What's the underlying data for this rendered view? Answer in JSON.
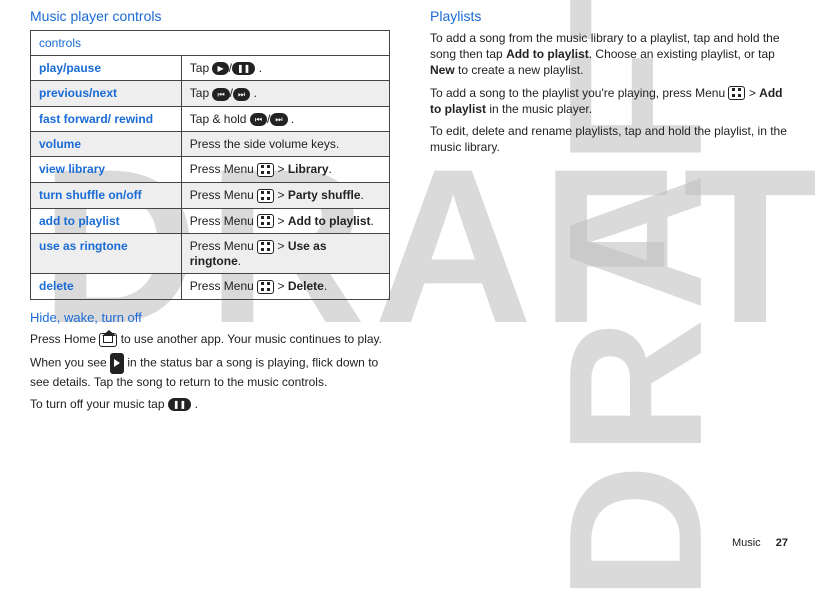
{
  "left": {
    "heading": "Music player controls",
    "tableHeader": "controls",
    "hideHeading": "Hide, wake, turn off"
  },
  "right": {
    "heading": "Playlists"
  },
  "rows": {
    "r0": {
      "label": "play/pause",
      "pre": "Tap ",
      "post": "."
    },
    "r1": {
      "label": "previous/next",
      "pre": "Tap ",
      "post": "."
    },
    "r2": {
      "label": "fast forward/ rewind",
      "pre": "Tap & hold ",
      "post": "."
    },
    "r3": {
      "label": "volume",
      "text": "Press the side volume keys."
    },
    "r4": {
      "label": "view library",
      "pre": "Press Menu",
      "mid": " > ",
      "bold": "Library",
      "post": "."
    },
    "r5": {
      "label": "turn shuffle on/off",
      "pre": "Press Menu",
      "mid": " > ",
      "bold": "Party shuffle",
      "post": "."
    },
    "r6": {
      "label": "add to playlist",
      "pre": "Press Menu",
      "mid": " > ",
      "bold": "Add to playlist",
      "post": "."
    },
    "r7": {
      "label": "use as ringtone",
      "pre": "Press Menu",
      "mid": " > ",
      "bold": "Use as ringtone",
      "post": "."
    },
    "r8": {
      "label": "delete",
      "pre": "Press Menu",
      "mid": " > ",
      "bold": "Delete",
      "post": "."
    }
  },
  "paras": {
    "hw1a": "Press Home",
    "hw1b": " to use another app. Your music continues to play.",
    "hw2a": "When you see ",
    "hw2b": " in the status bar a song is playing, flick down to see details. Tap the song to return to the music controls.",
    "hw3a": "To turn off your music tap ",
    "hw3b": ".",
    "pl1a": "To add a song from the music library to a playlist, tap and hold the song then tap ",
    "pl1bold1": "Add to playlist",
    "pl1b": ". Choose an existing playlist, or tap ",
    "pl1bold2": "New",
    "pl1c": " to create a new playlist.",
    "pl2a": "To add a song to the playlist you're playing, press Menu",
    "pl2mid": " > ",
    "pl2bold": "Add to playlist",
    "pl2b": " in the music player.",
    "pl3": "To edit, delete and rename playlists, tap and hold the playlist, in the music library."
  },
  "footer": {
    "section": "Music",
    "page": "27"
  },
  "watermark": "DRAFT"
}
